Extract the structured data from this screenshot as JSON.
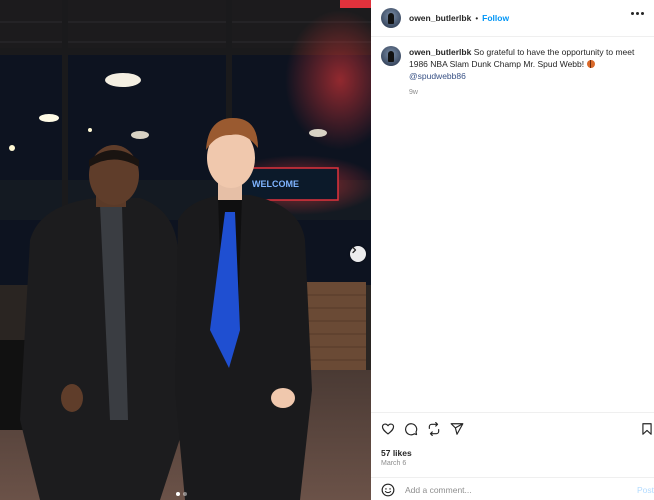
{
  "post": {
    "username": "owen_butlerlbk",
    "separator": "•",
    "follow_label": "Follow",
    "caption_text": "So grateful to have the opportunity to meet 1986 NBA Slam Dunk Champ Mr. Spud Webb! ",
    "caption_mention": "@spudwebb86",
    "age": "9w",
    "likes": "57 likes",
    "date": "March 6",
    "comment_placeholder": "Add a comment...",
    "post_label": "Post"
  },
  "photo": {
    "sign_text": "WELCOME",
    "carousel_count": 2,
    "carousel_active": 0
  },
  "icons": {
    "like": "heart-icon",
    "comment": "comment-icon",
    "share": "share-icon",
    "send": "send-icon",
    "save": "bookmark-icon",
    "more": "more-options-icon",
    "emoji": "emoji-icon",
    "next": "chevron-right-icon"
  },
  "colors": {
    "accent": "#0095f6",
    "tie": "#1f4fd1",
    "neon": "#e0323c"
  }
}
